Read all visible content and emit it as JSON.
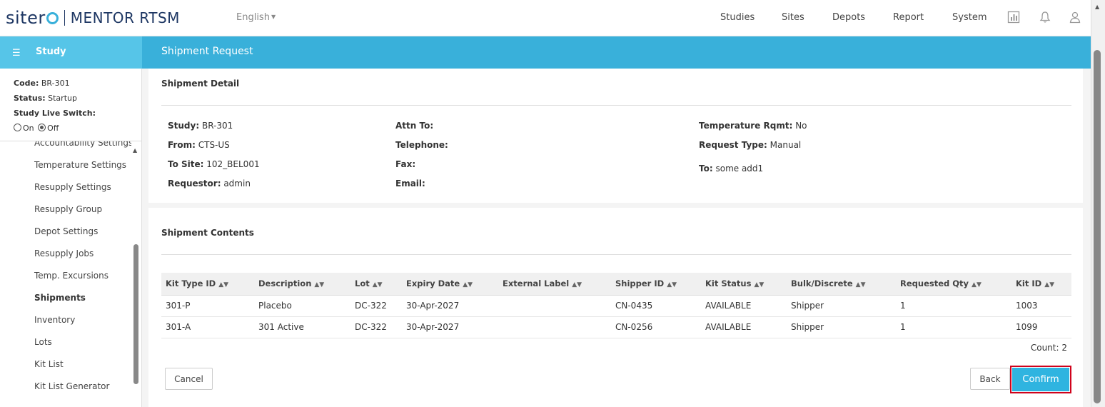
{
  "brand": {
    "sitero": "siter",
    "mentor": "MENTOR",
    "rtsm": "RTSM"
  },
  "language": "English",
  "nav": [
    "Studies",
    "Sites",
    "Depots",
    "Report",
    "System"
  ],
  "icons": [
    "report-icon",
    "bell-icon",
    "user-icon"
  ],
  "sidebar": {
    "title": "Study",
    "info": {
      "code_label": "Code:",
      "code": "BR-301",
      "status_label": "Status:",
      "status": "Startup",
      "live_switch_label": "Study Live Switch:",
      "on": "On",
      "off": "Off"
    },
    "items": [
      "Accountability Settings",
      "Temperature Settings",
      "Resupply Settings",
      "Resupply Group",
      "Depot Settings",
      "Resupply Jobs",
      "Temp. Excursions",
      "Shipments",
      "Inventory",
      "Lots",
      "Kit List",
      "Kit List Generator"
    ],
    "active": "Shipments"
  },
  "page": {
    "title": "Shipment Request",
    "detail": {
      "title": "Shipment Detail",
      "study_label": "Study:",
      "study": "BR-301",
      "from_label": "From:",
      "from": "CTS-US",
      "to_site_label": "To Site:",
      "to_site": "102_BEL001",
      "requestor_label": "Requestor:",
      "requestor": "admin",
      "attn_label": "Attn To:",
      "telephone_label": "Telephone:",
      "fax_label": "Fax:",
      "email_label": "Email:",
      "temp_label": "Temperature Rqmt:",
      "temp": "No",
      "request_type_label": "Request Type:",
      "request_type": "Manual",
      "to_label": "To:",
      "to": "some add1"
    },
    "contents": {
      "title": "Shipment Contents",
      "columns": [
        "Kit Type ID",
        "Description",
        "Lot",
        "Expiry Date",
        "External Label",
        "Shipper ID",
        "Kit Status",
        "Bulk/Discrete",
        "Requested Qty",
        "Kit ID"
      ],
      "rows": [
        [
          "301-P",
          "Placebo",
          "DC-322",
          "30-Apr-2027",
          "",
          "CN-0435",
          "AVAILABLE",
          "Shipper",
          "1",
          "1003"
        ],
        [
          "301-A",
          "301 Active",
          "DC-322",
          "30-Apr-2027",
          "",
          "CN-0256",
          "AVAILABLE",
          "Shipper",
          "1",
          "1099"
        ]
      ],
      "count": "Count: 2"
    },
    "buttons": {
      "cancel": "Cancel",
      "back": "Back",
      "confirm": "Confirm"
    }
  }
}
